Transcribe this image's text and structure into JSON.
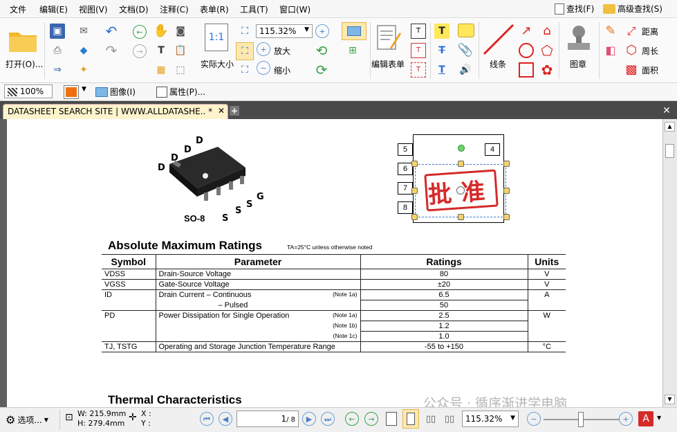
{
  "menubar": {
    "items": [
      "文件",
      "编辑(E)",
      "视图(V)",
      "文档(D)",
      "注释(C)",
      "表单(R)",
      "工具(T)",
      "窗口(W)"
    ],
    "find": "查找(F)",
    "advanced_find": "高级查找(S)"
  },
  "ribbon": {
    "open": "打开(O)...",
    "zoom_value": "115.32%",
    "actual_size": "实际大小",
    "zoom_in": "放大",
    "zoom_out": "缩小",
    "edit_form": "编辑表单",
    "lines": "线条",
    "stamp": "图章",
    "distance": "距离",
    "perimeter": "周长",
    "area": "面积"
  },
  "toolbar2": {
    "opacity": "100%",
    "image": "图像(I)",
    "properties": "属性(P)..."
  },
  "tab": {
    "title": "DATASHEET SEARCH SITE | WWW.ALLDATASHE.. *"
  },
  "document": {
    "package_labels": {
      "d1": "D",
      "d2": "D",
      "d3": "D",
      "d4": "D",
      "s1": "S",
      "s2": "S",
      "s3": "S",
      "g": "G",
      "pkg": "SO-8"
    },
    "pins": [
      "5",
      "6",
      "7",
      "8",
      "4"
    ],
    "stamp_text": "批准",
    "section1_title": "Absolute Maximum Ratings",
    "section1_note": "TA=25°C unless otherwise noted",
    "headers": [
      "Symbol",
      "Parameter",
      "Ratings",
      "Units"
    ],
    "rows": [
      {
        "sym": "VDSS",
        "param": "Drain-Source Voltage",
        "note": "",
        "rating": "80",
        "unit": "V"
      },
      {
        "sym": "VGSS",
        "param": "Gate-Source Voltage",
        "note": "",
        "rating": "±20",
        "unit": "V"
      },
      {
        "sym": "ID",
        "param": "Drain Current    – Continuous",
        "note": "(Note 1a)",
        "rating": "6.5",
        "unit": "A"
      },
      {
        "sym": "",
        "param": "– Pulsed",
        "note": "",
        "rating": "50",
        "unit": ""
      },
      {
        "sym": "PD",
        "param": "Power Dissipation for Single Operation",
        "note": "(Note 1a)",
        "rating": "2.5",
        "unit": "W"
      },
      {
        "sym": "",
        "param": "",
        "note": "(Note 1b)",
        "rating": "1.2",
        "unit": ""
      },
      {
        "sym": "",
        "param": "",
        "note": "(Note 1c)",
        "rating": "1.0",
        "unit": ""
      },
      {
        "sym": "TJ, TSTG",
        "param": "Operating and Storage Junction Temperature Range",
        "note": "",
        "rating": "-55 to +150",
        "unit": "°C"
      }
    ],
    "section2_title": "Thermal Characteristics",
    "watermark": "公众号 · 循序渐进学电脑"
  },
  "status": {
    "options": "选项...",
    "width": "W: 215.9mm",
    "height": "H: 279.4mm",
    "x": "X :",
    "y": "Y :",
    "page": "1",
    "page_total": "/ 8",
    "zoom": "115.32%"
  },
  "colors": {
    "accent": "#f5c343",
    "tab_bg": "#fdf3cc",
    "stamp": "#d42a2a"
  }
}
